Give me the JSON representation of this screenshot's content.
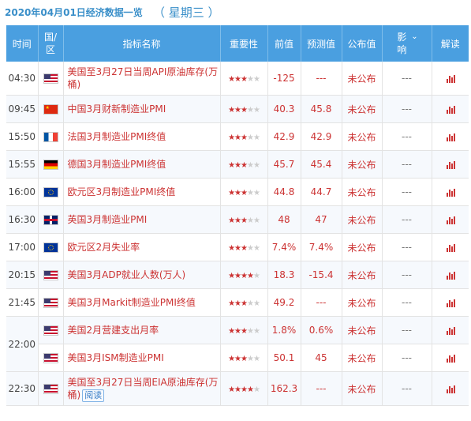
{
  "header": {
    "date_title": "2020年04月01日经济数据一览",
    "weekday": "（ 星期三 ）"
  },
  "columns": {
    "time": "时间",
    "country": "国/区",
    "indicator": "指标名称",
    "importance": "重要性",
    "previous": "前值",
    "forecast": "预测值",
    "actual": "公布值",
    "impact": "影响",
    "impact_arrow": "⌄",
    "interpret": "解读"
  },
  "colors": {
    "header_bg": "#4a9fe0",
    "accent_red": "#cc3333",
    "title_blue": "#3a8fc9"
  },
  "rows": [
    {
      "time": "04:30",
      "country": "us-flag",
      "name": "美国至3月27日当周API原油库存(万桶)",
      "stars": 3,
      "previous": "-125",
      "forecast": "---",
      "actual": "未公布",
      "impact": "---"
    },
    {
      "time": "09:45",
      "country": "cn-flag",
      "name": "中国3月财新制造业PMI",
      "stars": 3,
      "previous": "40.3",
      "forecast": "45.8",
      "actual": "未公布",
      "impact": "---"
    },
    {
      "time": "15:50",
      "country": "fr-flag",
      "name": "法国3月制造业PMI终值",
      "stars": 3,
      "previous": "42.9",
      "forecast": "42.9",
      "actual": "未公布",
      "impact": "---"
    },
    {
      "time": "15:55",
      "country": "de-flag",
      "name": "德国3月制造业PMI终值",
      "stars": 3,
      "previous": "45.7",
      "forecast": "45.4",
      "actual": "未公布",
      "impact": "---"
    },
    {
      "time": "16:00",
      "country": "eu-flag",
      "name": "欧元区3月制造业PMI终值",
      "stars": 3,
      "previous": "44.8",
      "forecast": "44.7",
      "actual": "未公布",
      "impact": "---"
    },
    {
      "time": "16:30",
      "country": "uk-flag",
      "name": "英国3月制造业PMI",
      "stars": 3,
      "previous": "48",
      "forecast": "47",
      "actual": "未公布",
      "impact": "---"
    },
    {
      "time": "17:00",
      "country": "eu-flag",
      "name": "欧元区2月失业率",
      "stars": 3,
      "previous": "7.4%",
      "forecast": "7.4%",
      "actual": "未公布",
      "impact": "---"
    },
    {
      "time": "20:15",
      "country": "us-flag",
      "name": "美国3月ADP就业人数(万人)",
      "stars": 4,
      "previous": "18.3",
      "forecast": "-15.4",
      "actual": "未公布",
      "impact": "---"
    },
    {
      "time": "21:45",
      "country": "us-flag",
      "name": "美国3月Markit制造业PMI终值",
      "stars": 3,
      "previous": "49.2",
      "forecast": "---",
      "actual": "未公布",
      "impact": "---"
    },
    {
      "time": "22:00",
      "country": "us-flag",
      "name": "美国2月营建支出月率",
      "stars": 3,
      "previous": "1.8%",
      "forecast": "0.6%",
      "actual": "未公布",
      "impact": "---"
    },
    {
      "time": "",
      "country": "us-flag",
      "name": "美国3月ISM制造业PMI",
      "stars": 3,
      "previous": "50.1",
      "forecast": "45",
      "actual": "未公布",
      "impact": "---"
    },
    {
      "time": "22:30",
      "country": "us-flag",
      "name": "美国至3月27日当周EIA原油库存(万桶)",
      "read": "阅读",
      "stars": 4,
      "previous": "162.3",
      "forecast": "---",
      "actual": "未公布",
      "impact": "---"
    }
  ]
}
